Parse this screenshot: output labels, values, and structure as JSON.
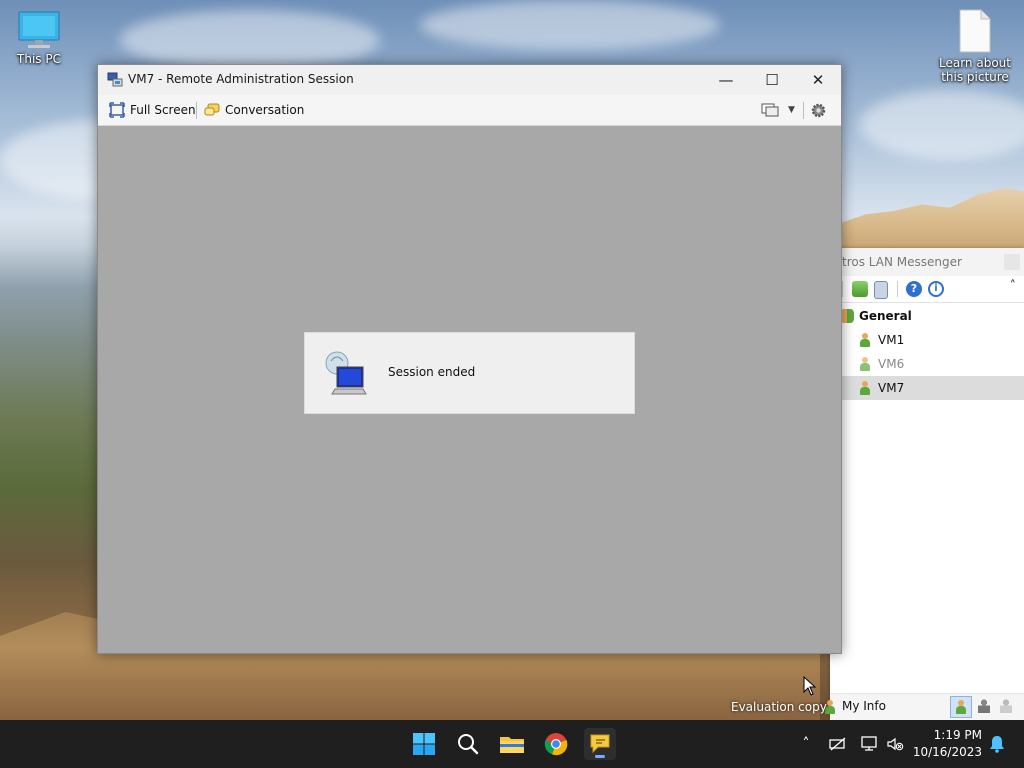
{
  "desktop": {
    "icons": [
      {
        "label": "This PC",
        "icon": "monitor-icon"
      },
      {
        "label": "Learn about\nthis picture",
        "icon": "file-icon"
      }
    ],
    "evaluation_text": "Evaluation copy"
  },
  "messenger": {
    "title": "ftros LAN Messenger",
    "group": "General",
    "contacts": [
      {
        "name": "VM1",
        "status": "online"
      },
      {
        "name": "VM6",
        "status": "offline"
      },
      {
        "name": "VM7",
        "status": "online",
        "selected": true
      }
    ],
    "my_info_label": "My Info"
  },
  "window": {
    "title": "VM7 - Remote Administration Session",
    "toolbar": {
      "full_screen_label": "Full Screen",
      "conversation_label": "Conversation"
    },
    "notice_text": "Session ended"
  },
  "taskbar": {
    "time": "1:19 PM",
    "date": "10/16/2023"
  },
  "colors": {
    "taskbar_bg": "#1f1f1f",
    "session_bg": "#a8a8a8",
    "accent": "#0078d4"
  }
}
